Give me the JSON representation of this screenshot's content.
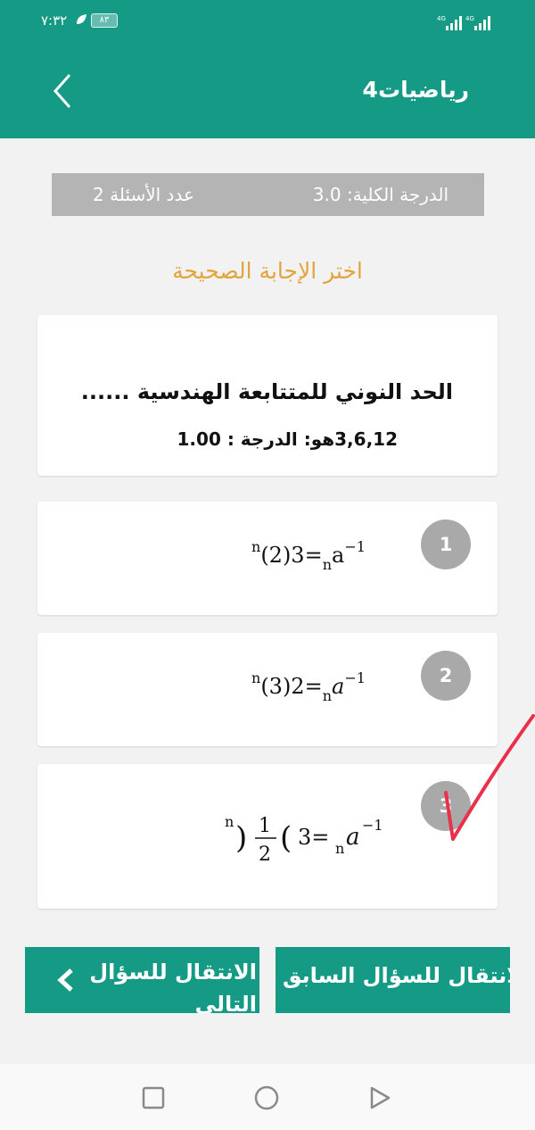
{
  "status_bar": {
    "time": "٧:٣٢",
    "battery": "٨٣",
    "signal_1": "4G",
    "signal_2": "4G"
  },
  "header": {
    "title": "رياضيات4"
  },
  "info": {
    "total_grade_label": "الدرجة الكلية:",
    "total_grade_value": "3.0",
    "question_count_label": "عدد الأسئلة",
    "question_count_value": "2"
  },
  "instruction": "اختر الإجابة الصحيحة",
  "question": {
    "line1": "الحد النوني للمتتابعة الهندسية ......",
    "line2": "3,6,12هو: الدرجة : 1.00"
  },
  "options": [
    {
      "number": "1",
      "formula": "a_n = 3(2)^(n-1)"
    },
    {
      "number": "2",
      "formula": "a_n = 2(3)^(n-1)"
    },
    {
      "number": "3",
      "formula": "a_n = 3(1/2)^(n-1)"
    }
  ],
  "buttons": {
    "next_label": "الانتقال للسؤال التالي",
    "prev_label": "الانتقال للسؤال السابق"
  },
  "colors": {
    "primary": "#159a85",
    "accent": "#e3a43e",
    "info_bar": "#b4b4b4",
    "option_badge": "#a9a9a9",
    "check_mark": "#e8324c"
  },
  "icons": [
    "back-chevron-icon",
    "chevron-left-icon",
    "recent-apps-icon",
    "home-icon",
    "back-triangle-icon"
  ]
}
